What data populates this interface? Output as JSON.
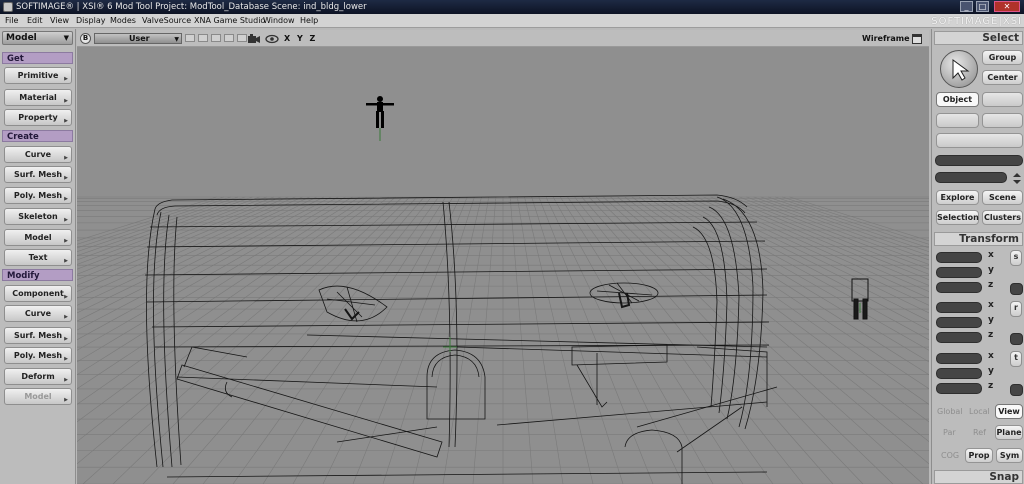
{
  "window": {
    "title": "SOFTIMAGE® | XSI® 6 Mod Tool Project: ModTool_Database    Scene: ind_bldg_lower",
    "controls": [
      "_",
      "□",
      "✕"
    ]
  },
  "menubar": {
    "items": [
      "File",
      "Edit",
      "View",
      "Display",
      "Modes",
      "ValveSource",
      "XNA Game Studio",
      "Window",
      "Help"
    ],
    "brand": "SOFTIMAGE|XSI"
  },
  "left_panel": {
    "mode": "Model",
    "sections": [
      {
        "label": "Get",
        "buttons": [
          "Primitive",
          "Material",
          "Property"
        ]
      },
      {
        "label": "Create",
        "buttons": [
          "Curve",
          "Surf. Mesh",
          "Poly. Mesh",
          "Skeleton",
          "Model",
          "Text"
        ]
      },
      {
        "label": "Modify",
        "buttons": [
          "Component",
          "Curve",
          "Surf. Mesh",
          "Poly. Mesh",
          "Deform",
          "Model"
        ]
      }
    ]
  },
  "viewport": {
    "camera_badge": "B",
    "camera": "User",
    "axes": "X Y Z",
    "display_mode": "Wireframe",
    "icons": [
      "camera-icon",
      "eye-icon",
      "maximize-icon"
    ]
  },
  "right_panel": {
    "select": {
      "title": "Select",
      "group": "Group",
      "center": "Center",
      "object": "Object",
      "explore": "Explore",
      "scene": "Scene",
      "selection": "Selection",
      "clusters": "Clusters"
    },
    "transform": {
      "title": "Transform",
      "groups": [
        {
          "axes": [
            "x",
            "y",
            "z"
          ],
          "tool": "s"
        },
        {
          "axes": [
            "x",
            "y",
            "z"
          ],
          "tool": "r"
        },
        {
          "axes": [
            "x",
            "y",
            "z"
          ],
          "tool": "t"
        }
      ],
      "modes": [
        "Global",
        "Local",
        "View"
      ],
      "ref_modes": [
        "Par",
        "Ref",
        "Plane"
      ],
      "cog": "COG",
      "prop": "Prop",
      "sym": "Sym"
    },
    "snap": {
      "title": "Snap"
    }
  }
}
